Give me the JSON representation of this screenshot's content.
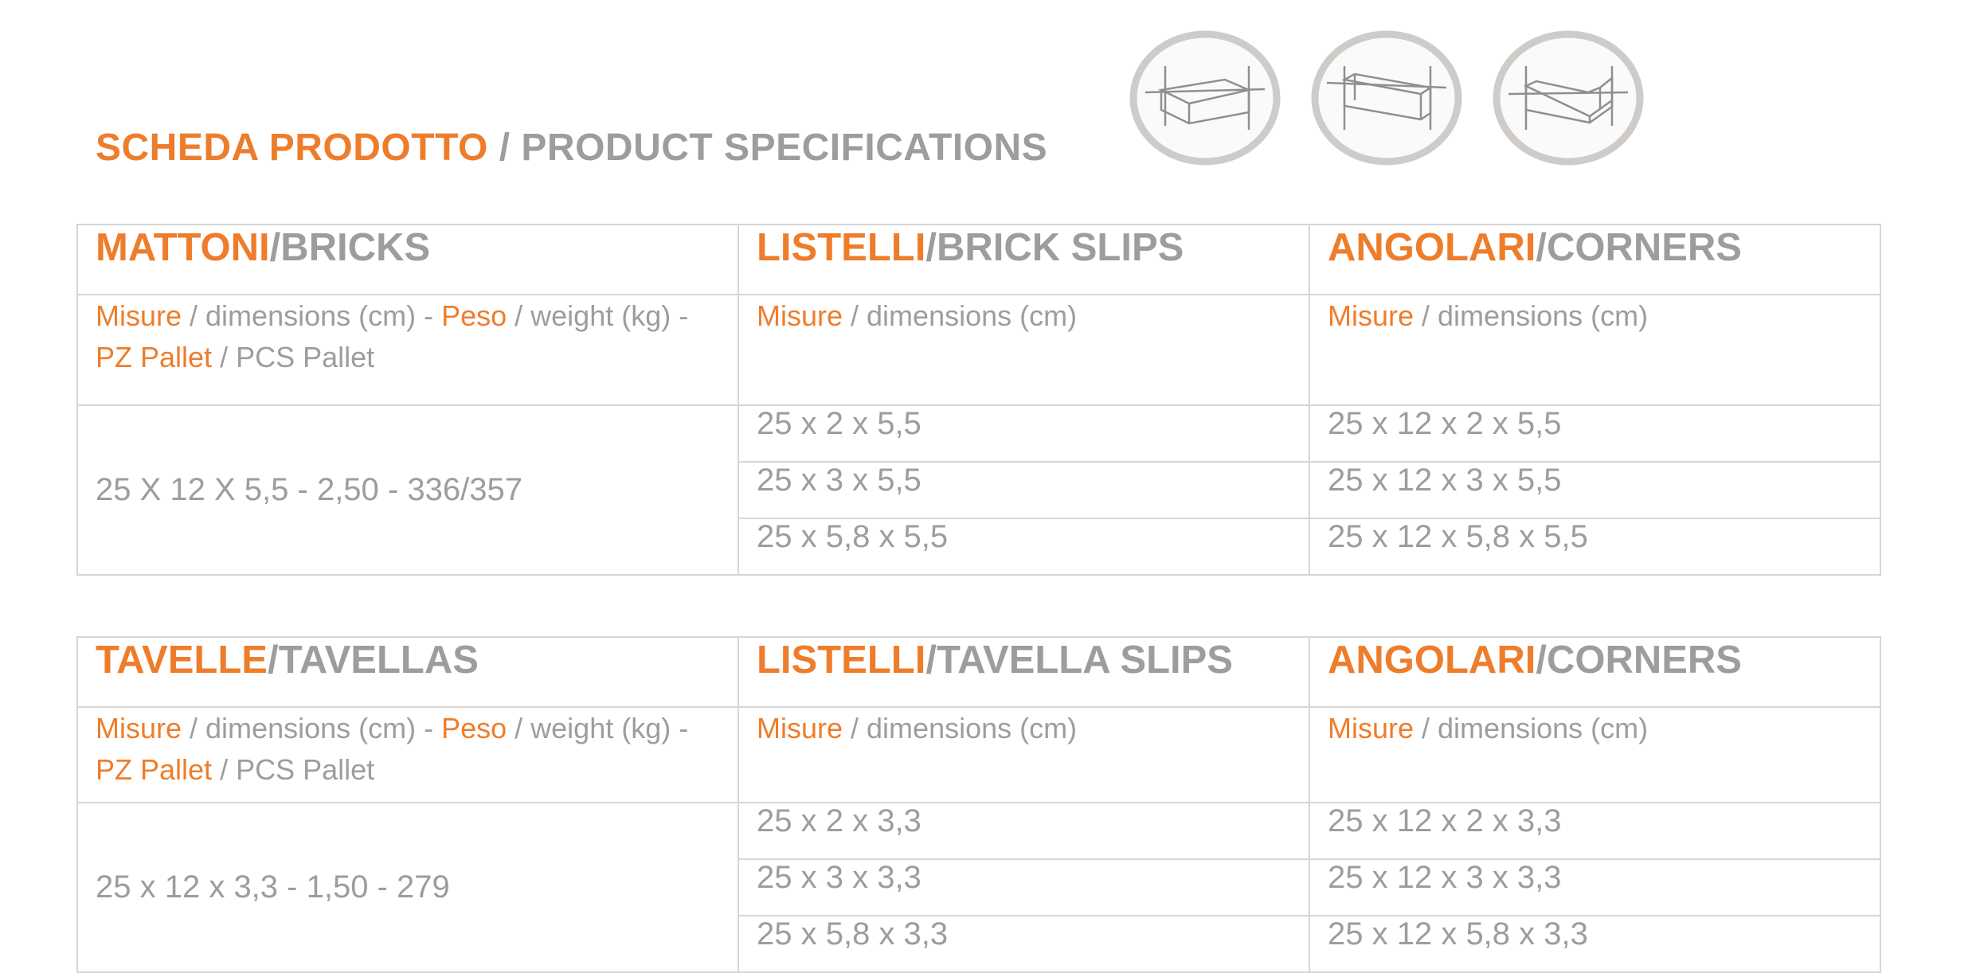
{
  "title": {
    "primary": "SCHEDA PRODOTTO",
    "secondary": " / PRODUCT SPECIFICATIONS"
  },
  "icons": [
    "brick-icon",
    "brick-slip-icon",
    "corner-icon"
  ],
  "labels": {
    "misure": "Misure",
    "dimensions": " / dimensions (cm)",
    "dimensions_sep": " / dimensions (cm) - ",
    "peso": "Peso",
    "weight_sep": " / weight (kg) -",
    "pz_pallet": "PZ Pallet",
    "pcs_pallet": " / PCS Pallet"
  },
  "tables": [
    {
      "col1": {
        "it": "MATTONI",
        "en": "/BRICKS"
      },
      "col2": {
        "it": "LISTELLI",
        "en": "/BRICK SLIPS"
      },
      "col3": {
        "it": "ANGOLARI",
        "en": "/CORNERS"
      },
      "main_value": "25 X 12 X 5,5 - 2,50 - 336/357",
      "slips": [
        "25 x 2 x 5,5",
        "25 x 3 x 5,5",
        "25 x 5,8 x 5,5"
      ],
      "corners": [
        "25 x 12 x 2 x 5,5",
        "25 x 12 x 3 x 5,5",
        "25 x 12 x 5,8 x 5,5"
      ]
    },
    {
      "col1": {
        "it": "TAVELLE",
        "en": "/TAVELLAS"
      },
      "col2": {
        "it": "LISTELLI",
        "en": "/TAVELLA SLIPS"
      },
      "col3": {
        "it": "ANGOLARI",
        "en": "/CORNERS"
      },
      "main_value": "25 x 12 x 3,3 - 1,50 - 279",
      "slips": [
        "25 x 2 x 3,3",
        "25 x 3 x 3,3",
        "25 x 5,8 x 3,3"
      ],
      "corners": [
        "25 x 12 x 2 x 3,3",
        "25 x 12 x 3 x 3,3",
        "25 x 12 x 5,8 x 3,3"
      ]
    }
  ],
  "colors": {
    "accent": "#ee7d2b",
    "text": "#9d9d9d",
    "border": "#d6d6d6"
  }
}
